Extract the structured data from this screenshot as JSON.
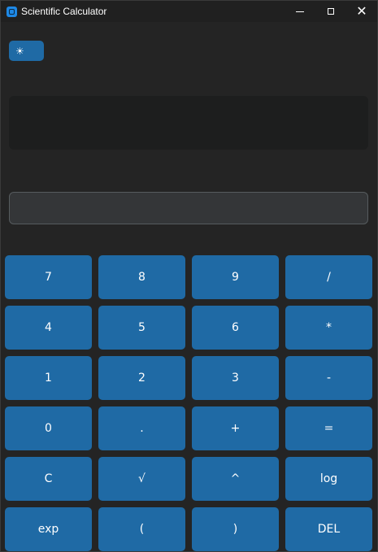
{
  "window": {
    "title": "Scientific Calculator",
    "controls": {
      "minimize": "",
      "maximize": "",
      "close": "✕"
    }
  },
  "theme_toggle": {
    "icon": "☀",
    "icon_name": "sun-icon"
  },
  "display": {
    "history": "",
    "entry_value": ""
  },
  "keypad": {
    "keys": [
      "7",
      "8",
      "9",
      "/",
      "4",
      "5",
      "6",
      "*",
      "1",
      "2",
      "3",
      "-",
      "0",
      ".",
      "+",
      "=",
      "C",
      "√",
      "^",
      "log",
      "exp",
      "(",
      ")",
      "DEL"
    ]
  },
  "colors": {
    "accent": "#1f6aa5",
    "background": "#242424",
    "titlebar": "#202020",
    "display_bg": "#1d1e1e",
    "entry_bg": "#343638",
    "entry_border": "#565b5e"
  }
}
